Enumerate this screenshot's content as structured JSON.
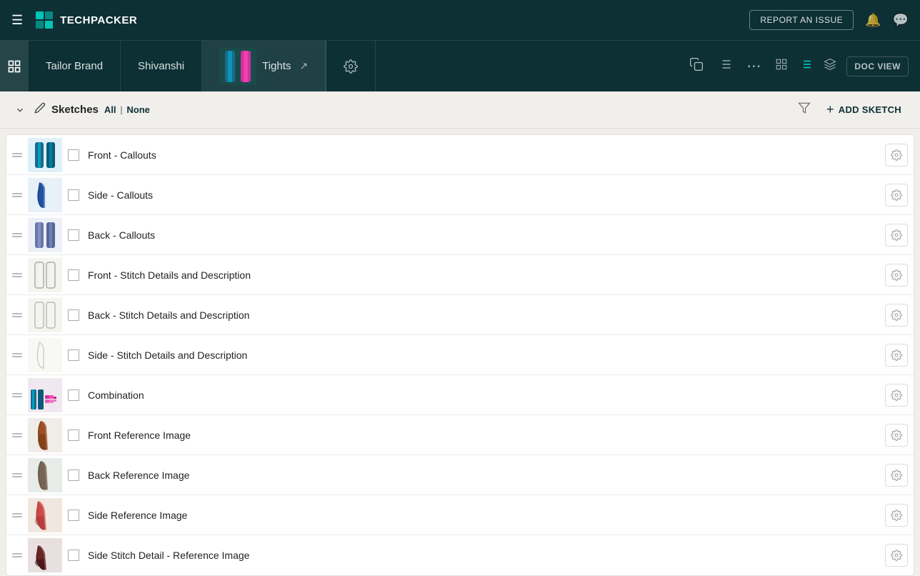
{
  "app": {
    "name": "TECHPACKER",
    "hamburger_label": "☰"
  },
  "topnav": {
    "report_btn": "REPORT AN ISSUE",
    "bell_icon": "🔔",
    "chat_icon": "💬"
  },
  "subnav": {
    "collapse_label": "❮",
    "brand": "Tailor Brand",
    "designer": "Shivanshi",
    "product": "Tights",
    "external_link": "↗",
    "settings_icon": "⚙",
    "copy_icon": "⧉",
    "filter_icon": "⊟",
    "more_icon": "⋯",
    "grid_icon": "⊞",
    "list_icon": "≡",
    "layers_icon": "⊕",
    "doc_view": "DOC VIEW"
  },
  "sketches_header": {
    "title": "Sketches",
    "select_all": "All",
    "select_none": "None",
    "select_divider": "|",
    "add_sketch": "ADD SKETCH"
  },
  "sketches": [
    {
      "id": 1,
      "name": "Front - Callouts",
      "thumb_type": "front-callouts"
    },
    {
      "id": 2,
      "name": "Side - Callouts",
      "thumb_type": "side-callouts"
    },
    {
      "id": 3,
      "name": "Back - Callouts",
      "thumb_type": "back-callouts"
    },
    {
      "id": 4,
      "name": "Front - Stitch Details and Description",
      "thumb_type": "stitch"
    },
    {
      "id": 5,
      "name": "Back - Stitch Details and Description",
      "thumb_type": "stitch"
    },
    {
      "id": 6,
      "name": "Side - Stitch Details and Description",
      "thumb_type": "stitch-light"
    },
    {
      "id": 7,
      "name": "Combination",
      "thumb_type": "combo"
    },
    {
      "id": 8,
      "name": "Front Reference Image",
      "thumb_type": "ref-front"
    },
    {
      "id": 9,
      "name": "Back Reference Image",
      "thumb_type": "ref-back"
    },
    {
      "id": 10,
      "name": "Side Reference Image",
      "thumb_type": "ref-side"
    },
    {
      "id": 11,
      "name": "Side Stitch Detail - Reference Image",
      "thumb_type": "ref-side-stitch"
    }
  ]
}
